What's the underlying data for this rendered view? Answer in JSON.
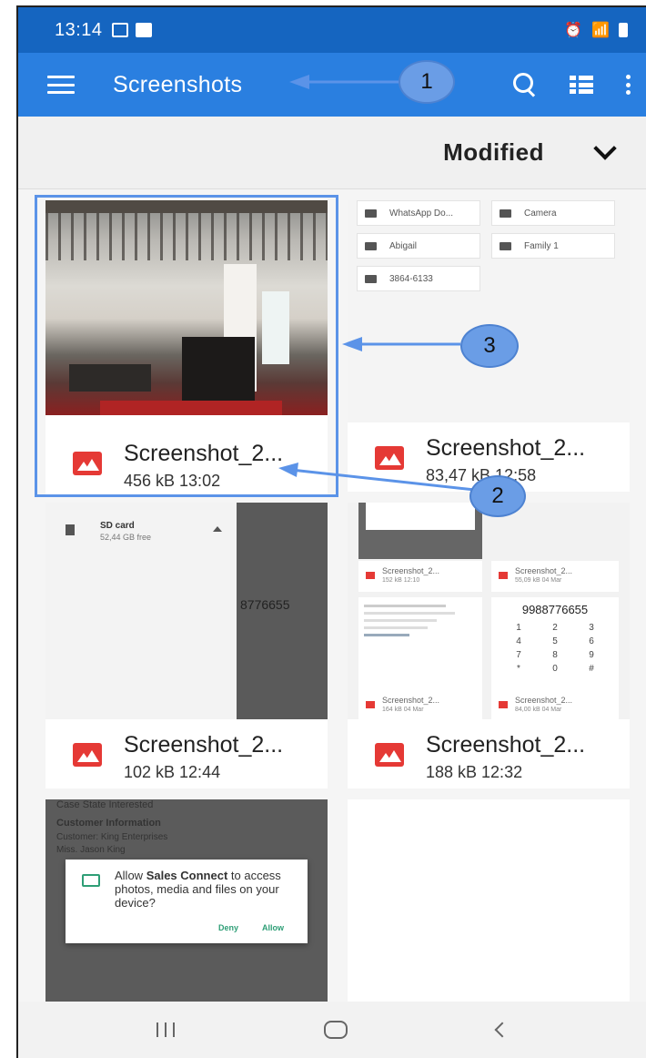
{
  "status_bar": {
    "time": "13:14"
  },
  "app_bar": {
    "title": "Screenshots"
  },
  "sort": {
    "label": "Modified"
  },
  "folders": [
    "WhatsApp Do...",
    "Camera",
    "Abigail",
    "Family 1",
    "3864-6133"
  ],
  "files": [
    {
      "name": "Screenshot_2...",
      "meta": "456 kB 13:02"
    },
    {
      "name": "Screenshot_2...",
      "meta": "83,47 kB 12:58"
    },
    {
      "name": "Screenshot_2...",
      "meta": "102 kB 12:44"
    },
    {
      "name": "Screenshot_2...",
      "meta": "188 kB 12:32"
    }
  ],
  "thumb3": {
    "sd_card": "SD card",
    "sd_free": "52,44 GB free",
    "number": "8776655"
  },
  "thumb4": {
    "file_a": "Screenshot_2...",
    "size_a": "152 kB 12:10",
    "file_b": "Screenshot_2...",
    "size_b": "55,09 kB 04 Mar",
    "file_c": "Screenshot_2...",
    "size_c": "164 kB 04 Mar",
    "file_d": "Screenshot_2...",
    "size_d": "84,00 kB 04 Mar",
    "number": "9988776655",
    "keys": [
      "1",
      "2",
      "3",
      "4",
      "5",
      "6",
      "7",
      "8",
      "9",
      "*",
      "0",
      "#"
    ]
  },
  "thumb5": {
    "line1": "Case State Interested",
    "heading": "Customer Information",
    "line2": "Customer: King Enterprises",
    "line3": "Miss. Jason King",
    "dialog_pre": "Allow ",
    "dialog_app": "Sales Connect",
    "dialog_post": " to access photos, media and files on your device?",
    "deny": "Deny",
    "allow": "Allow"
  },
  "callouts": [
    "1",
    "2",
    "3"
  ],
  "colors": {
    "status_bar": "#1565c0",
    "app_bar": "#2a7fe0",
    "file_icon": "#e53935",
    "annotation": "#5b93e8"
  }
}
